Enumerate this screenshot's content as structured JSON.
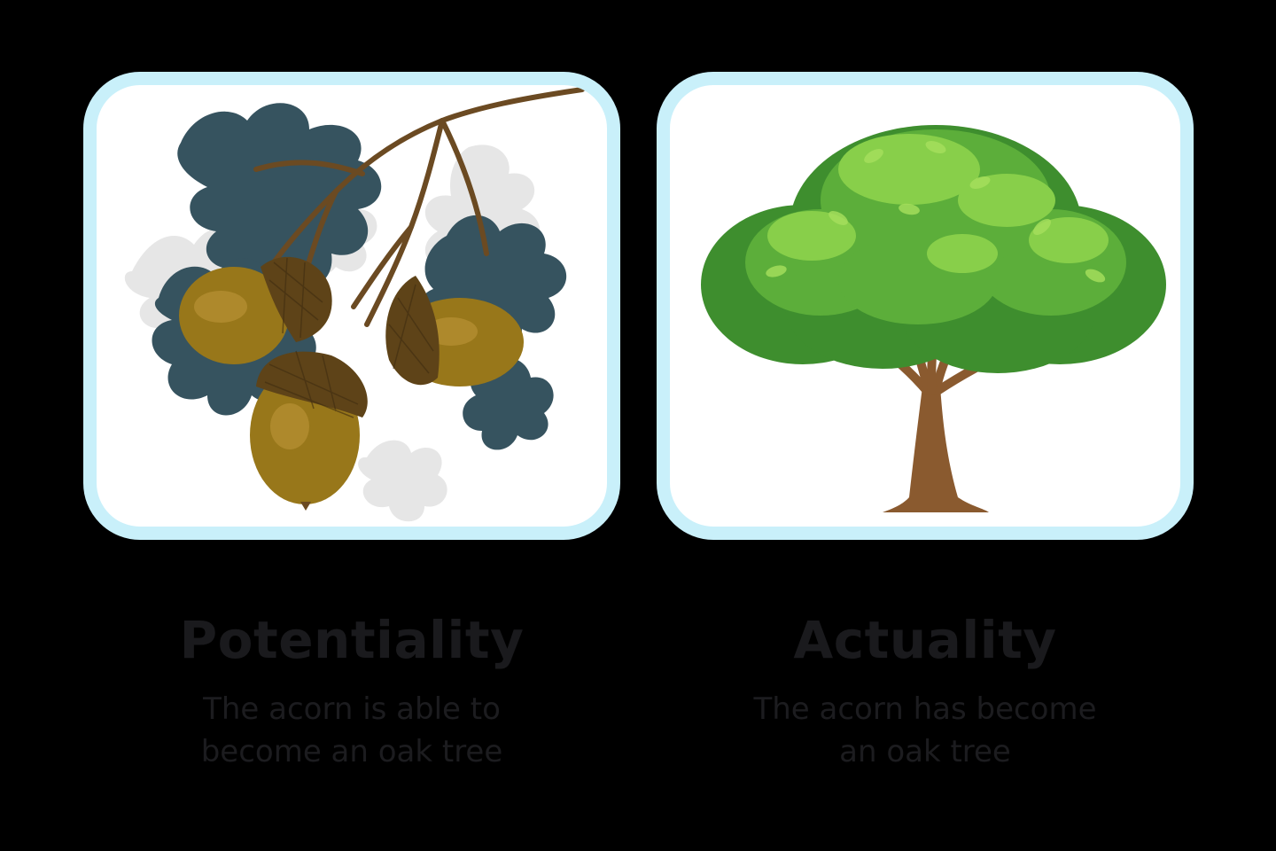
{
  "colors": {
    "background": "#000000",
    "card_border": "#c9f0fa",
    "card_fill": "#ffffff",
    "text": "#1a1a1d"
  },
  "panels": [
    {
      "illustration": "acorns-on-oak-branch",
      "title": "Potentiality",
      "description": "The acorn is able to become an oak tree"
    },
    {
      "illustration": "oak-tree",
      "title": "Actuality",
      "description": "The acorn has become an oak tree"
    }
  ]
}
